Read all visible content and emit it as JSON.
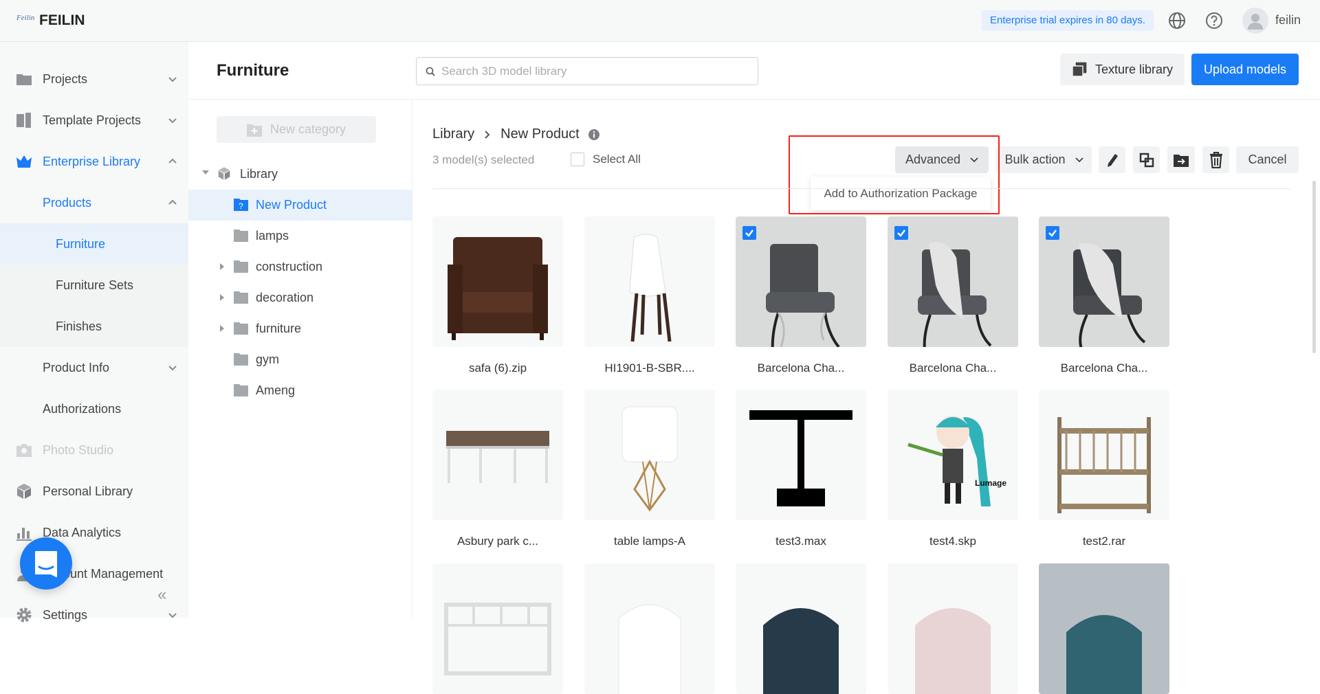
{
  "topbar": {
    "logo_mark": "Feilin",
    "brand": "FEILIN",
    "trial_notice": "Enterprise trial expires in 80 days.",
    "username": "feilin"
  },
  "sidebar": {
    "items": [
      {
        "label": "Projects"
      },
      {
        "label": "Template Projects"
      },
      {
        "label": "Enterprise Library"
      },
      {
        "label": "Products"
      },
      {
        "label": "Furniture"
      },
      {
        "label": "Furniture Sets"
      },
      {
        "label": "Finishes"
      },
      {
        "label": "Product Info"
      },
      {
        "label": "Authorizations"
      },
      {
        "label": "Photo Studio"
      },
      {
        "label": "Personal Library"
      },
      {
        "label": "Data Analytics"
      },
      {
        "label": "Account Management"
      },
      {
        "label": "Settings"
      }
    ]
  },
  "header": {
    "title": "Furniture",
    "search_placeholder": "Search 3D model library",
    "texture_library": "Texture library",
    "upload_models": "Upload models"
  },
  "tree": {
    "new_category": "New category",
    "root": "Library",
    "items": [
      {
        "label": "New Product"
      },
      {
        "label": "lamps"
      },
      {
        "label": "construction"
      },
      {
        "label": "decoration"
      },
      {
        "label": "furniture"
      },
      {
        "label": "gym"
      },
      {
        "label": "Ameng"
      }
    ]
  },
  "main": {
    "breadcrumb": [
      "Library",
      "New Product"
    ],
    "selected_count": "3 model(s) selected",
    "select_all": "Select All",
    "advanced": "Advanced",
    "bulk_action": "Bulk action",
    "cancel": "Cancel",
    "advanced_menu": [
      "Add to Authorization Package"
    ]
  },
  "models": [
    {
      "name": "safa (6).zip",
      "selected": false
    },
    {
      "name": "HI1901-B-SBR....",
      "selected": false
    },
    {
      "name": "Barcelona Cha...",
      "selected": true
    },
    {
      "name": "Barcelona Cha...",
      "selected": true
    },
    {
      "name": "Barcelona Cha...",
      "selected": true
    },
    {
      "name": "Asbury park c...",
      "selected": false
    },
    {
      "name": "table lamps-A",
      "selected": false
    },
    {
      "name": "test3.max",
      "selected": false
    },
    {
      "name": "test4.skp",
      "selected": false
    },
    {
      "name": "test2.rar",
      "selected": false
    },
    {
      "name": "",
      "selected": false
    },
    {
      "name": "",
      "selected": false
    },
    {
      "name": "",
      "selected": false
    },
    {
      "name": "",
      "selected": false
    },
    {
      "name": "",
      "selected": false
    }
  ],
  "colors": {
    "accent": "#1a7cf5",
    "highlight": "#f5221b",
    "sidebar_bg": "#f7f8f8",
    "selected_bg": "#e9f1fb"
  }
}
